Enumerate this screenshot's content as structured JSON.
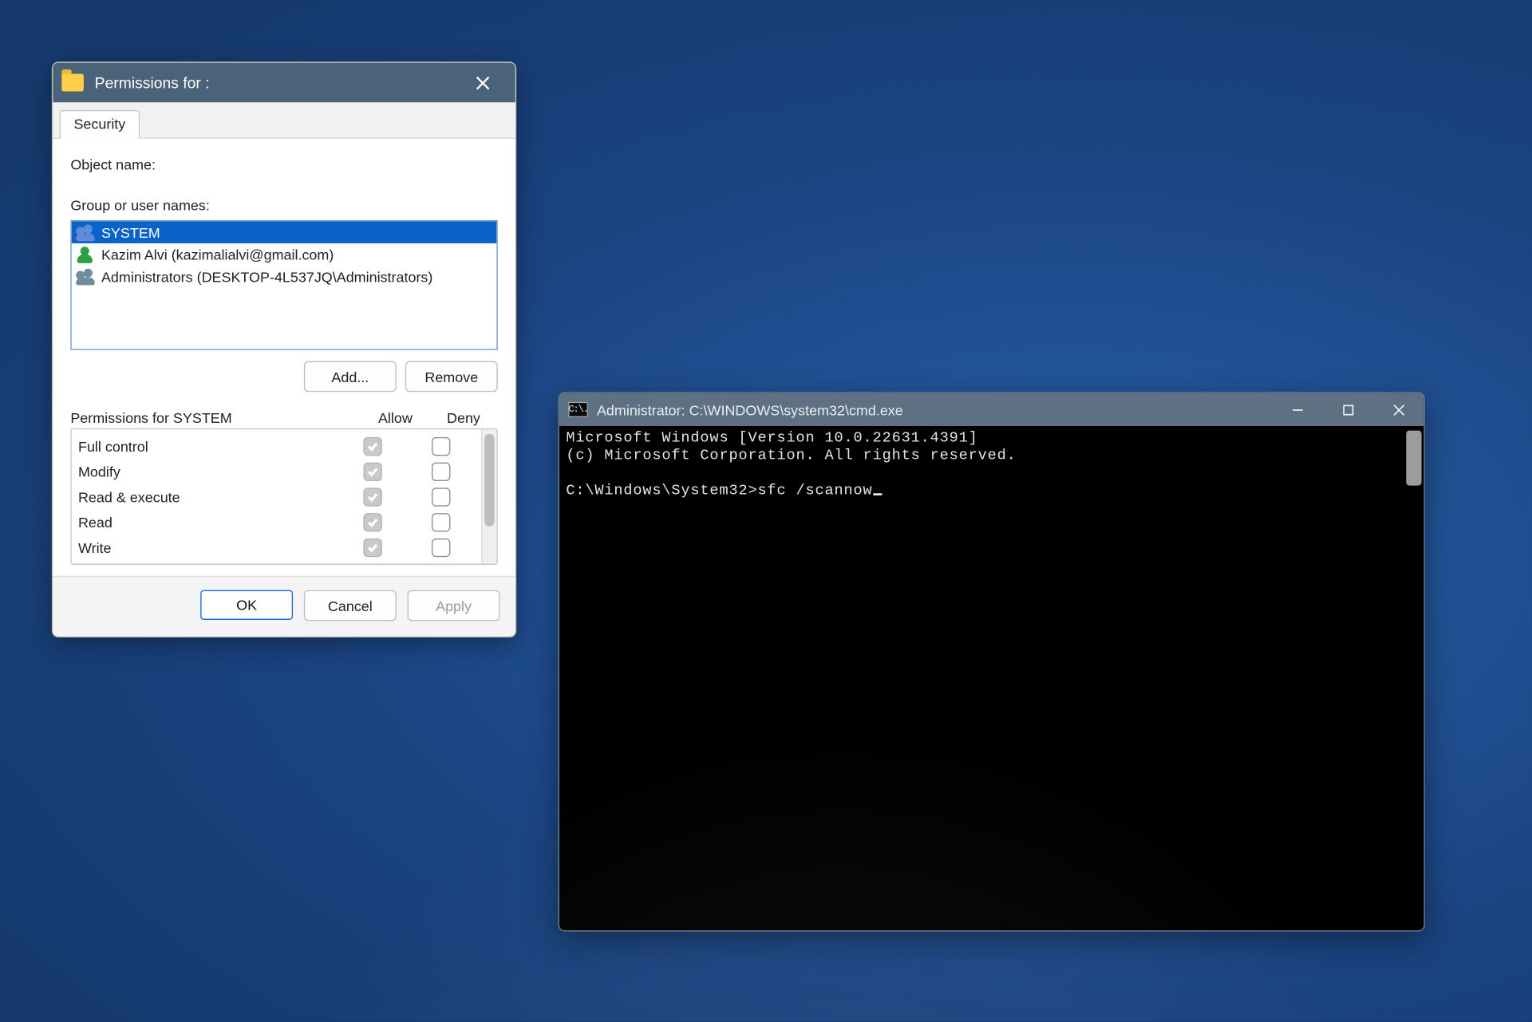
{
  "permissions": {
    "title": "Permissions for :",
    "tab": "Security",
    "object_name_label": "Object name:",
    "group_label": "Group or user names:",
    "users": [
      {
        "name": "SYSTEM",
        "icon": "group",
        "selected": true
      },
      {
        "name": "Kazim Alvi (kazimalialvi@gmail.com)",
        "icon": "single",
        "selected": false
      },
      {
        "name": "Administrators (DESKTOP-4L537JQ\\Administrators)",
        "icon": "group2",
        "selected": false
      }
    ],
    "add_label": "Add...",
    "remove_label": "Remove",
    "perms_for_label": "Permissions for SYSTEM",
    "allow_label": "Allow",
    "deny_label": "Deny",
    "rows": [
      {
        "name": "Full control",
        "allow": true,
        "deny": false
      },
      {
        "name": "Modify",
        "allow": true,
        "deny": false
      },
      {
        "name": "Read & execute",
        "allow": true,
        "deny": false
      },
      {
        "name": "Read",
        "allow": true,
        "deny": false
      },
      {
        "name": "Write",
        "allow": true,
        "deny": false
      }
    ],
    "ok_label": "OK",
    "cancel_label": "Cancel",
    "apply_label": "Apply"
  },
  "cmd": {
    "title": "Administrator: C:\\WINDOWS\\system32\\cmd.exe",
    "icon_text": "C:\\.",
    "line1": "Microsoft Windows [Version 10.0.22631.4391]",
    "line2": "(c) Microsoft Corporation. All rights reserved.",
    "prompt": "C:\\Windows\\System32>",
    "command": "sfc /scannow"
  }
}
